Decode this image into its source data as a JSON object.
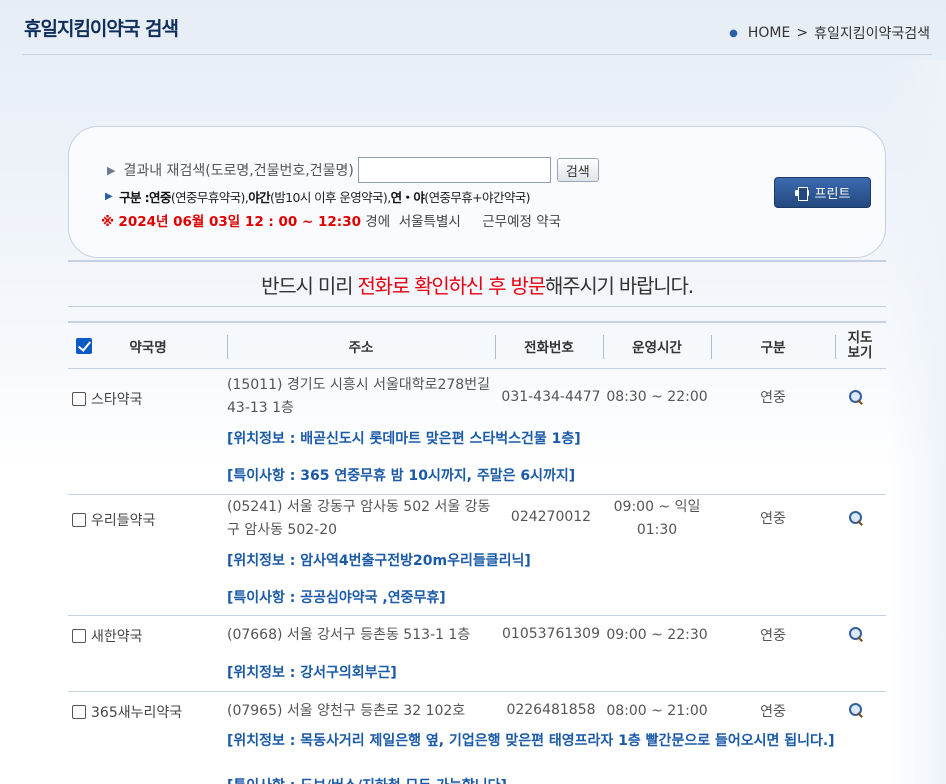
{
  "header": {
    "title": "휴일지킴이약국 검색",
    "breadcrumb": [
      "HOME",
      ">",
      "휴일지킴이약국검색"
    ]
  },
  "search": {
    "label": "결과내 재검색(도로명,건물번호,건물명)",
    "input_value": "",
    "button": "검색",
    "legend_prefix": "구분 : ",
    "legend": [
      {
        "bold": "연중",
        "rest": "(연중무휴약국), "
      },
      {
        "bold": "야간",
        "rest": "(밤10시 이후 운영약국), "
      },
      {
        "bold": "연・야",
        "rest": "(연중무휴+야간약국)"
      }
    ],
    "notice_mark": "※",
    "date_text": "2024년 06월 03일 12 : 00 ~ 12:30",
    "notice_rest": " 경에  서울특별시     근무예정 약국",
    "print_button": "프린트"
  },
  "notice": {
    "part1": "반드시 미리 ",
    "part2": "전화로 확인하신 후 방문",
    "part3": "해주시기 바랍니다."
  },
  "table": {
    "headers": [
      "약국명",
      "주소",
      "전화번호",
      "운영시간",
      "구분",
      "지도보기"
    ],
    "header_checkbox_checked": true,
    "rows": [
      {
        "name": "스타약국",
        "address": "(15011) 경기도 시흥시 서울대학로278번길 43-13 1층",
        "tel": "031-434-4477",
        "hours": "08:30 ~ 22:00",
        "kind": "연중",
        "location": "[위치정보 : 배곧신도시 롯데마트 맞은편 스타벅스건물 1층]",
        "special": "[특이사항 : 365 연중무휴 밤 10시까지, 주말은 6시까지]"
      },
      {
        "name": "우리들약국",
        "address": "(05241) 서울 강동구 암사동 502 서울 강동구 암사동 502-20",
        "tel": "024270012",
        "hours": "09:00 ~ 익일 01:30",
        "kind": "연중",
        "location": "[위치정보 : 암사역4번출구전방20m우리들클리닉]",
        "special": "[특이사항 : 공공심야약국 ,연중무휴]"
      },
      {
        "name": "새한약국",
        "address": "(07668) 서울 강서구 등촌동 513-1 1층",
        "tel": "01053761309",
        "hours": "09:00 ~ 22:30",
        "kind": "연중",
        "location": "[위치정보 : 강서구의회부근]"
      },
      {
        "name": "365새누리약국",
        "address": "(07965) 서울 양천구 등촌로 32 102호",
        "tel": "0226481858",
        "hours": "08:00 ~ 21:00",
        "kind": "연중",
        "location": "[위치정보 : 목동사거리 제일은행 옆, 기업은행 맞은편 태영프라자 1층 빨간문으로 들어오시면 됩니다.]",
        "special": "[특이사항 : 도보/버스/지하철 모두 가능합니다]"
      }
    ]
  },
  "icons": {
    "map": "magnifier-icon",
    "print": "printer-icon",
    "bullet": "triangle-right-icon"
  },
  "colors": {
    "title": "#0f2e5c",
    "accent_blue": "#1a5aa8",
    "red": "#e60012",
    "border": "#c5d1e2"
  }
}
